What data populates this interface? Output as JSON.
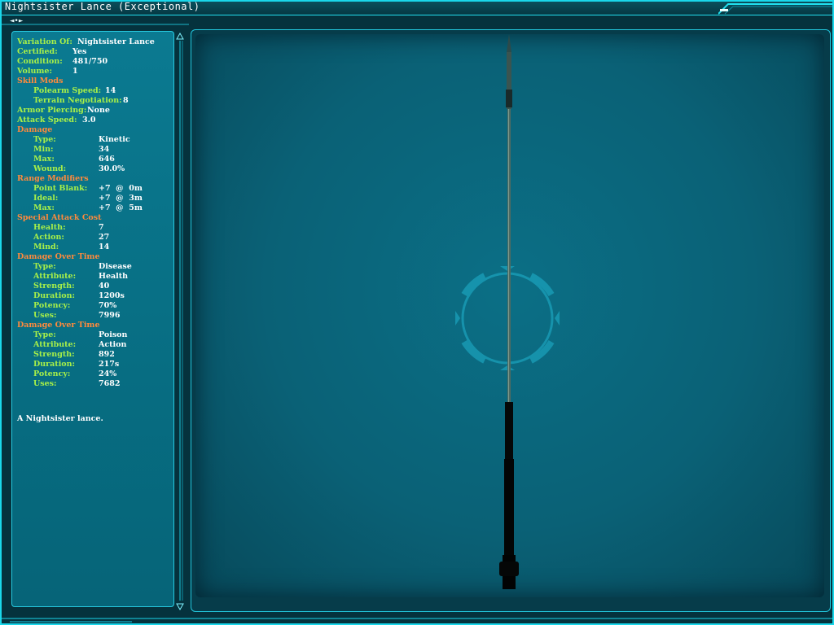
{
  "window": {
    "title": "Nightsister Lance (Exceptional)"
  },
  "nav": {
    "arrows": "◄•►"
  },
  "attributes": {
    "variation_label": "Variation Of:",
    "variation_value": "Nightsister Lance",
    "certified_label": "Certified:",
    "certified_value": "Yes",
    "condition_label": "Condition:",
    "condition_value": "481/750",
    "volume_label": "Volume:",
    "volume_value": "1",
    "skill_mods_header": "Skill Mods",
    "polearm_speed_label": "Polearm Speed:",
    "polearm_speed_value": "14",
    "terrain_label": "Terrain Negotiation:",
    "terrain_value": "8",
    "armor_piercing_label": "Armor Piercing:",
    "armor_piercing_value": "None",
    "attack_speed_label": "Attack Speed:",
    "attack_speed_value": "3.0",
    "damage_header": "Damage",
    "dmg_type_label": "Type:",
    "dmg_type_value": "Kinetic",
    "dmg_min_label": "Min:",
    "dmg_min_value": "34",
    "dmg_max_label": "Max:",
    "dmg_max_value": "646",
    "dmg_wound_label": "Wound:",
    "dmg_wound_value": "30.0%",
    "range_header": "Range Modifiers",
    "range_pb_label": "Point Blank:",
    "range_pb_value": "+7  @  0m",
    "range_ideal_label": "Ideal:",
    "range_ideal_value": "+7  @  3m",
    "range_max_label": "Max:",
    "range_max_value": "+7  @  5m",
    "special_header": "Special Attack Cost",
    "sp_health_label": "Health:",
    "sp_health_value": "7",
    "sp_action_label": "Action:",
    "sp_action_value": "27",
    "sp_mind_label": "Mind:",
    "sp_mind_value": "14",
    "dot1_header": "Damage Over Time",
    "dot1_type_label": "Type:",
    "dot1_type_value": "Disease",
    "dot1_attr_label": "Attribute:",
    "dot1_attr_value": "Health",
    "dot1_strength_label": "Strength:",
    "dot1_strength_value": "40",
    "dot1_duration_label": "Duration:",
    "dot1_duration_value": "1200s",
    "dot1_potency_label": "Potency:",
    "dot1_potency_value": "70%",
    "dot1_uses_label": "Uses:",
    "dot1_uses_value": "7996",
    "dot2_header": "Damage Over Time",
    "dot2_type_label": "Type:",
    "dot2_type_value": "Poison",
    "dot2_attr_label": "Attribute:",
    "dot2_attr_value": "Action",
    "dot2_strength_label": "Strength:",
    "dot2_strength_value": "892",
    "dot2_duration_label": "Duration:",
    "dot2_duration_value": "217s",
    "dot2_potency_label": "Potency:",
    "dot2_potency_value": "24%",
    "dot2_uses_label": "Uses:",
    "dot2_uses_value": "7682",
    "description": "A Nightsister lance."
  },
  "icons": {
    "nav": "nav-arrows-icon",
    "scroll_up": "scroll-up-arrow-icon",
    "scroll_down": "scroll-down-arrow-icon",
    "reticle": "target-reticle-icon",
    "item_model": "lance-model-icon"
  },
  "colors": {
    "frame_accent": "#1ad7ea",
    "panel_bg": "#0b7a91",
    "label_green": "#a8f048",
    "header_orange": "#ff8a3c",
    "value_white": "#ffffff"
  }
}
